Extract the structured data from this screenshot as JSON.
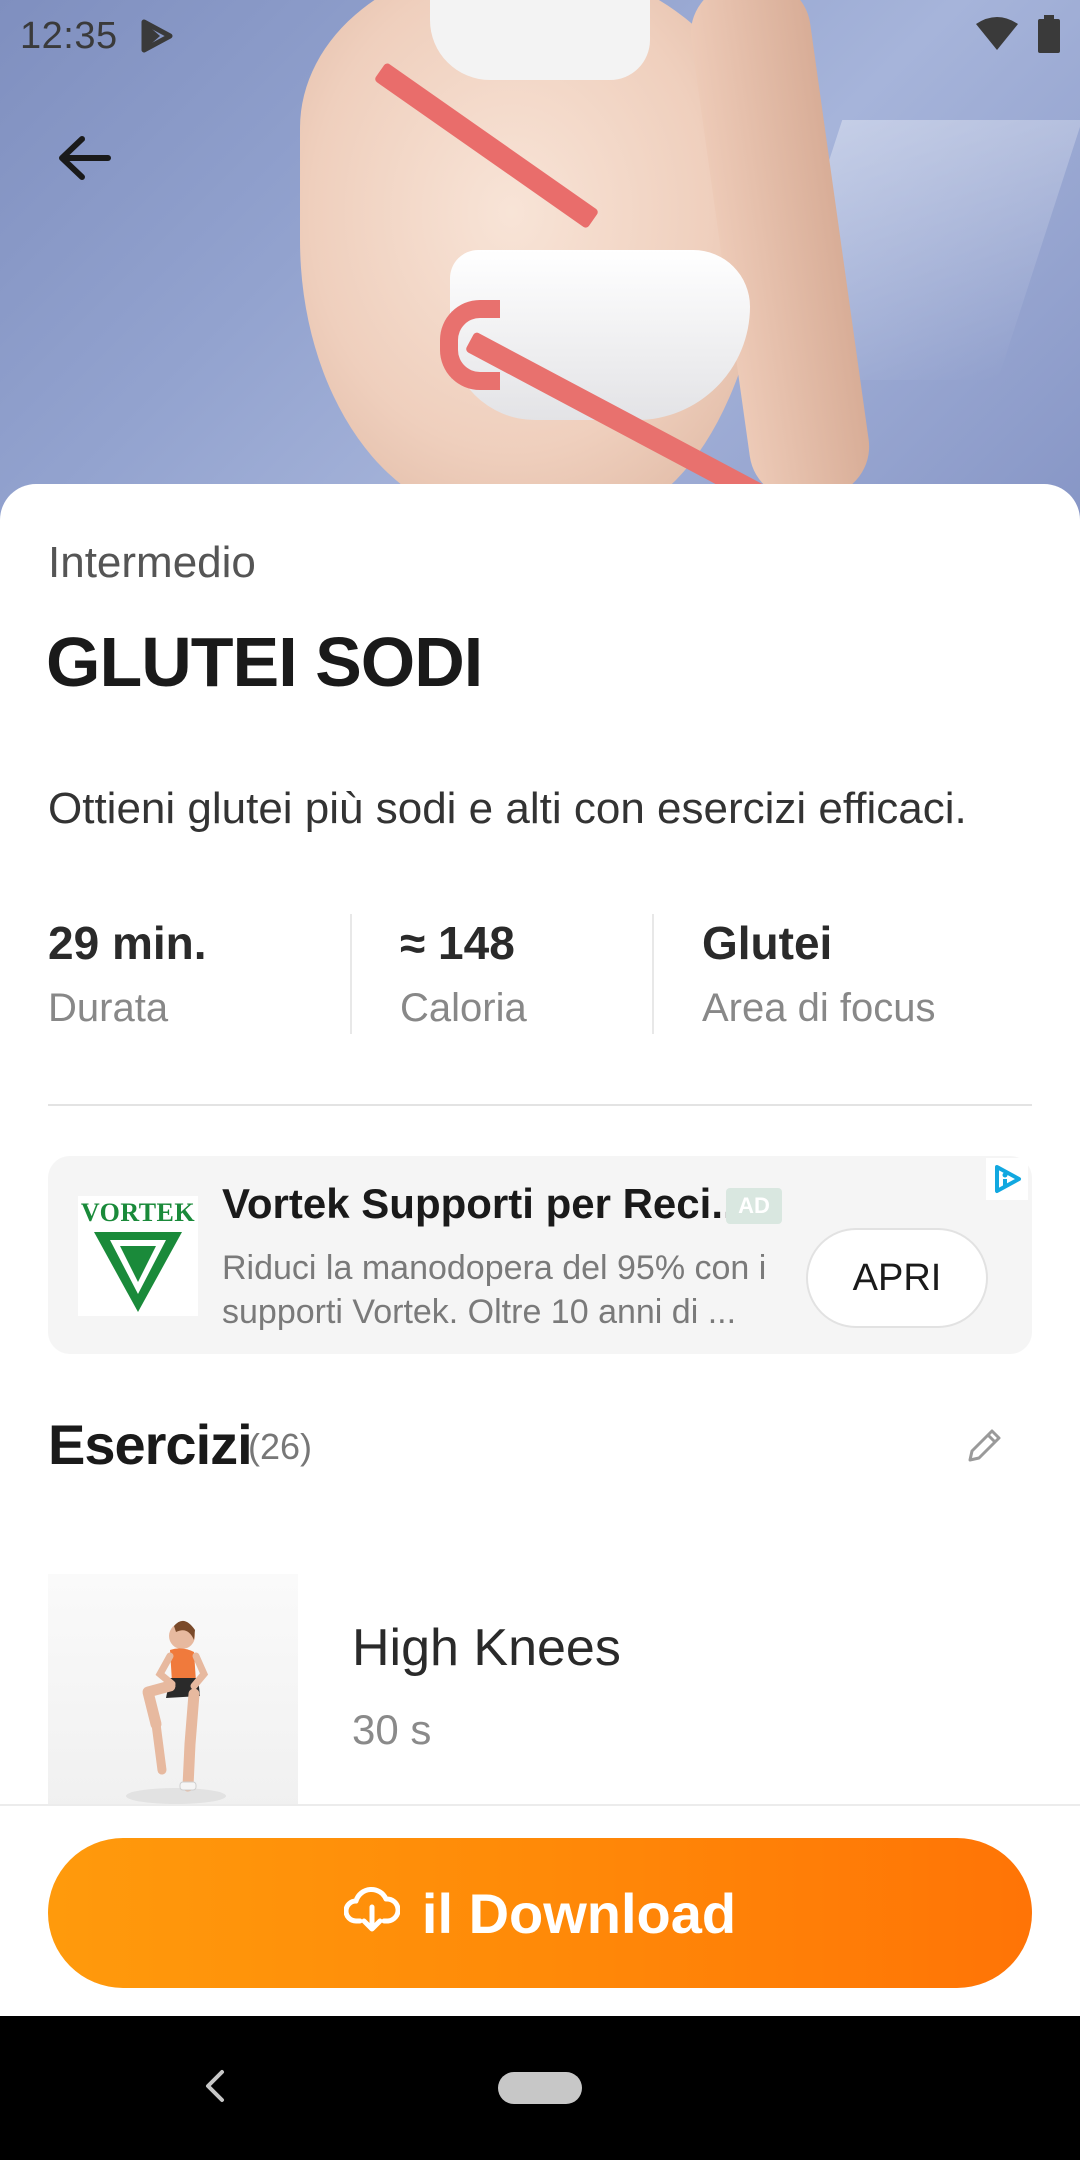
{
  "status_bar": {
    "time": "12:35"
  },
  "workout": {
    "level": "Intermedio",
    "title": "GLUTEI SODI",
    "description": "Ottieni glutei più sodi e alti con esercizi efficaci.",
    "stats": [
      {
        "value": "29 min.",
        "label": "Durata"
      },
      {
        "value": "≈ 148",
        "label": "Caloria"
      },
      {
        "value": "Glutei",
        "label": "Area di focus"
      }
    ]
  },
  "ad": {
    "logo_text": "VORTEK",
    "title": "Vortek Supporti per Reci...",
    "badge": "AD",
    "text": "Riduci la manodopera del 95% con i supporti Vortek. Oltre 10 anni di ...",
    "button": "APRI"
  },
  "exercises": {
    "heading": "Esercizi",
    "count": "(26)",
    "items": [
      {
        "name": "High Knees",
        "duration": "30 s"
      }
    ]
  },
  "download_button": {
    "label": "il Download"
  },
  "colors": {
    "accent_start": "#ff9a0c",
    "accent_end": "#ff7406",
    "ad_logo_green": "#1a8a3a"
  },
  "icons": {
    "back": "arrow-left-icon",
    "edit": "pencil-icon",
    "download": "cloud-download-icon",
    "ad_choices": "ad-choices-icon"
  }
}
